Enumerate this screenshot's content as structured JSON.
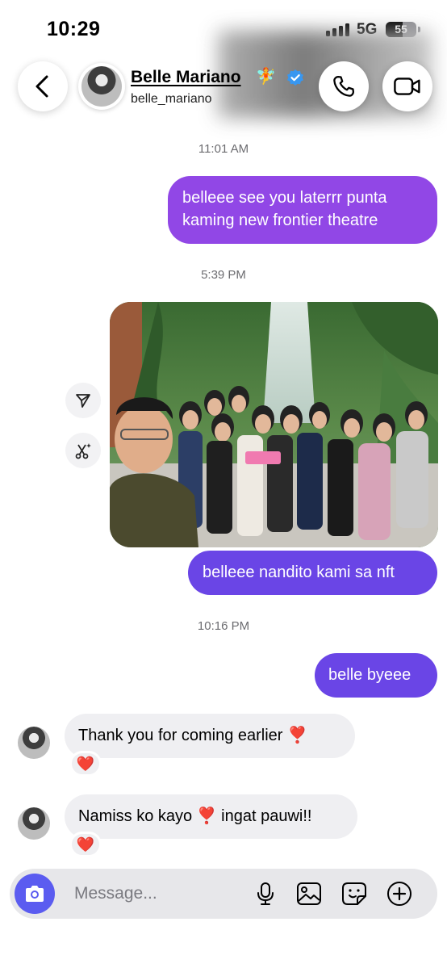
{
  "status_bar": {
    "time": "10:29",
    "network": "5G",
    "battery": "55",
    "battery_level": 0.55
  },
  "header": {
    "name": "Belle Mariano",
    "name_emoji": "🧚",
    "handle": "belle_mariano",
    "icons": {
      "back": "back-chevron-icon",
      "call": "phone-icon",
      "video": "video-camera-icon",
      "verified": "verified-badge-icon"
    }
  },
  "messages": [
    {
      "type": "timestamp",
      "text": "11:01 AM"
    },
    {
      "type": "outgoing",
      "text": "belleee see you laterrr punta kaming new frontier theatre"
    },
    {
      "type": "timestamp",
      "text": "5:39 PM"
    },
    {
      "type": "outgoing-photo",
      "alt_icon": "group-photo-image"
    },
    {
      "type": "outgoing",
      "text": "belleee nandito kami sa nft"
    },
    {
      "type": "timestamp",
      "text": "10:16 PM"
    },
    {
      "type": "outgoing",
      "text": "belle byeee"
    },
    {
      "type": "incoming",
      "text": "Thank you for coming earlier ❣️",
      "reaction": "❤️"
    },
    {
      "type": "incoming",
      "text": "Namiss ko kayo ❣️ ingat pauwi!!",
      "reaction": "❤️"
    }
  ],
  "photo_actions": {
    "share": "share-icon",
    "ai_edit": "sparkle-edit-icon"
  },
  "composer": {
    "placeholder": "Message...",
    "icons": {
      "camera": "camera-icon",
      "mic": "microphone-icon",
      "gallery": "gallery-icon",
      "sticker": "sticker-icon",
      "add": "plus-circle-icon"
    }
  },
  "colors": {
    "bubble_gradient_top": "#9147e6",
    "bubble_gradient_bottom": "#6a45e6",
    "incoming_bubble": "#efeff2",
    "camera_button": "#5b5cf0",
    "verified": "#3897f0"
  }
}
